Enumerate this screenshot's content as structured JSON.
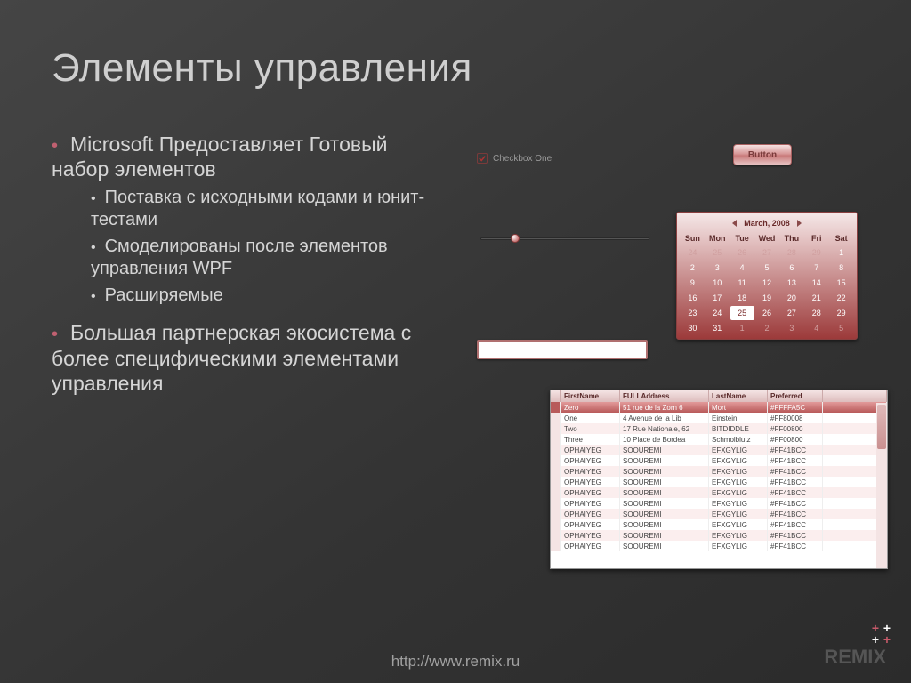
{
  "title": "Элементы управления",
  "bullets": {
    "b1": "Microsoft Предоставляет Готовый набор элементов",
    "b1_sub": {
      "s1": "Поставка с исходными кодами и юнит-тестами",
      "s2": "Смоделированы после элементов управления WPF",
      "s3": "Расширяемые"
    },
    "b2": "Большая партнерская экосистема с более специфическими элементами управления"
  },
  "checkbox_label": "Checkbox One",
  "button_label": "Button",
  "calendar": {
    "month": "March, 2008",
    "day_headers": [
      "Sun",
      "Mon",
      "Tue",
      "Wed",
      "Thu",
      "Fri",
      "Sat"
    ],
    "weeks": [
      {
        "days": [
          "24",
          "25",
          "26",
          "27",
          "28",
          "29",
          "1"
        ],
        "dim": [
          0,
          1,
          2,
          3,
          4,
          5
        ]
      },
      {
        "days": [
          "2",
          "3",
          "4",
          "5",
          "6",
          "7",
          "8"
        ],
        "dim": []
      },
      {
        "days": [
          "9",
          "10",
          "11",
          "12",
          "13",
          "14",
          "15"
        ],
        "dim": []
      },
      {
        "days": [
          "16",
          "17",
          "18",
          "19",
          "20",
          "21",
          "22"
        ],
        "dim": []
      },
      {
        "days": [
          "23",
          "24",
          "25",
          "26",
          "27",
          "28",
          "29"
        ],
        "dim": [],
        "sel": 2
      },
      {
        "days": [
          "30",
          "31",
          "1",
          "2",
          "3",
          "4",
          "5"
        ],
        "dim": [
          2,
          3,
          4,
          5,
          6
        ]
      }
    ]
  },
  "grid": {
    "headers": [
      "",
      "FirstName",
      "FULLAddress",
      "LastName",
      "Preferred"
    ],
    "rows": [
      {
        "sel": true,
        "cells": [
          "Zero",
          "51 rue de la Zorn 6",
          "Mort",
          "#FFFFA5C"
        ]
      },
      {
        "cells": [
          "One",
          "4 Avenue de la Lib",
          "Einstein",
          "#FF80008"
        ]
      },
      {
        "cells": [
          "Two",
          "17 Rue Nationale, 62",
          "BITDIDDLE",
          "#FF00800"
        ]
      },
      {
        "cells": [
          "Three",
          "10 Place de Bordea",
          "Schmolblutz",
          "#FF00800"
        ]
      },
      {
        "cells": [
          "OPHAIYEG",
          "SOOUREMI",
          "EFXGYLIG",
          "#FF41BCC"
        ]
      },
      {
        "cells": [
          "OPHAIYEG",
          "SOOUREMI",
          "EFXGYLIG",
          "#FF41BCC"
        ]
      },
      {
        "cells": [
          "OPHAIYEG",
          "SOOUREMI",
          "EFXGYLIG",
          "#FF41BCC"
        ]
      },
      {
        "cells": [
          "OPHAIYEG",
          "SOOUREMI",
          "EFXGYLIG",
          "#FF41BCC"
        ]
      },
      {
        "cells": [
          "OPHAIYEG",
          "SOOUREMI",
          "EFXGYLIG",
          "#FF41BCC"
        ]
      },
      {
        "cells": [
          "OPHAIYEG",
          "SOOUREMI",
          "EFXGYLIG",
          "#FF41BCC"
        ]
      },
      {
        "cells": [
          "OPHAIYEG",
          "SOOUREMI",
          "EFXGYLIG",
          "#FF41BCC"
        ]
      },
      {
        "cells": [
          "OPHAIYEG",
          "SOOUREMI",
          "EFXGYLIG",
          "#FF41BCC"
        ]
      },
      {
        "cells": [
          "OPHAIYEG",
          "SOOUREMI",
          "EFXGYLIG",
          "#FF41BCC"
        ]
      },
      {
        "cells": [
          "OPHAIYEG",
          "SOOUREMI",
          "EFXGYLIG",
          "#FF41BCC"
        ]
      }
    ]
  },
  "footer_url": "http://www.remix.ru",
  "logo_text": "REMIX"
}
